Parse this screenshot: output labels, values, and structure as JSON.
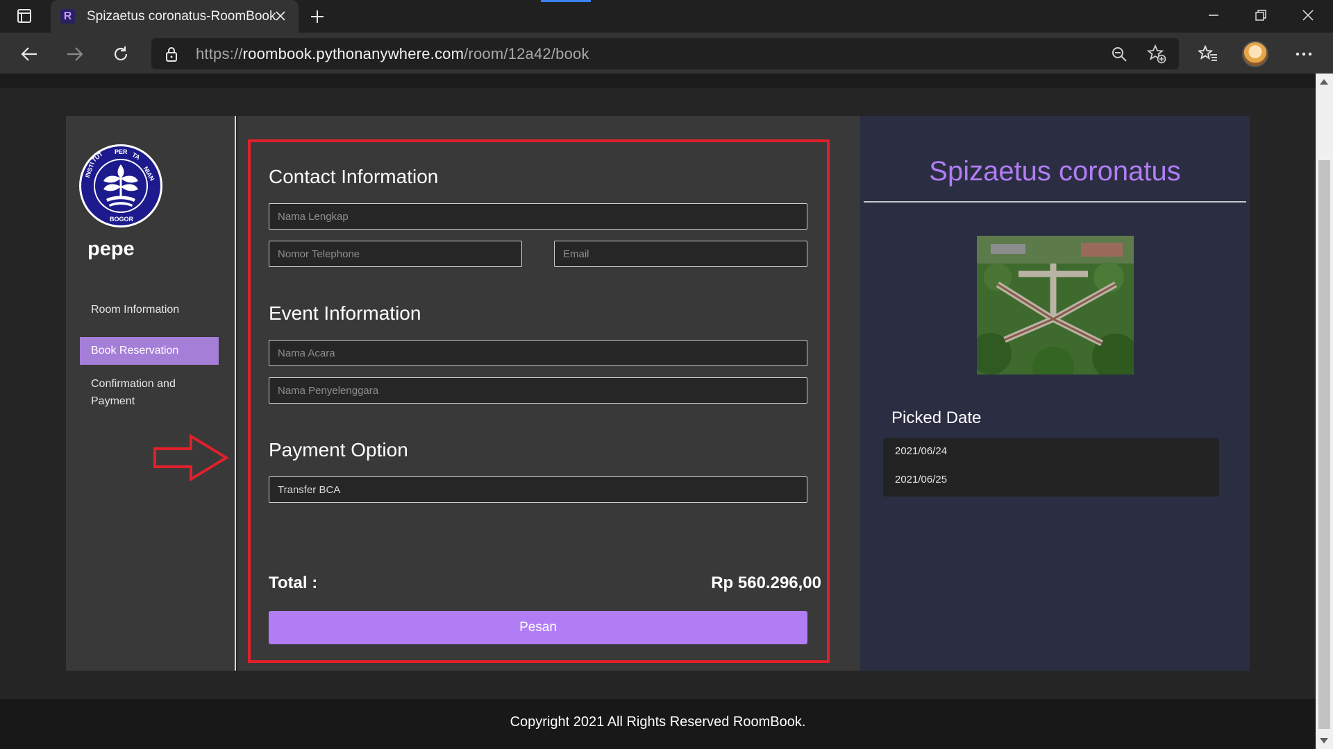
{
  "browser": {
    "tab_title": "Spizaetus coronatus-RoomBook",
    "tab_favicon": "R",
    "url_scheme": "https://",
    "url_host": "roombook.pythonanywhere.com",
    "url_path": "/room/12a42/book"
  },
  "sidebar": {
    "username": "pepe",
    "items": [
      {
        "label": "Room Information",
        "active": false
      },
      {
        "label": "Book Reservation",
        "active": true
      },
      {
        "label": "Confirmation and Payment",
        "active": false
      }
    ]
  },
  "form": {
    "contact_title": "Contact Information",
    "full_name_placeholder": "Nama Lengkap",
    "phone_placeholder": "Nomor Telephone",
    "email_placeholder": "Email",
    "event_title": "Event Information",
    "event_name_placeholder": "Nama Acara",
    "organizer_placeholder": "Nama Penyelenggara",
    "payment_title": "Payment Option",
    "payment_value": "Transfer BCA",
    "total_label": "Total :",
    "total_value": "Rp 560.296,00",
    "submit_label": "Pesan"
  },
  "room": {
    "name": "Spizaetus coronatus",
    "picked_date_title": "Picked Date",
    "dates": [
      "2021/06/24",
      "2021/06/25"
    ]
  },
  "footer": {
    "copyright": "Copyright 2021 All Rights Reserved RoomBook."
  },
  "colors": {
    "accent": "#b17df5",
    "sidebar_active": "#a57ed8",
    "highlight_border": "#e0202a",
    "room_panel": "#2b2e42"
  }
}
